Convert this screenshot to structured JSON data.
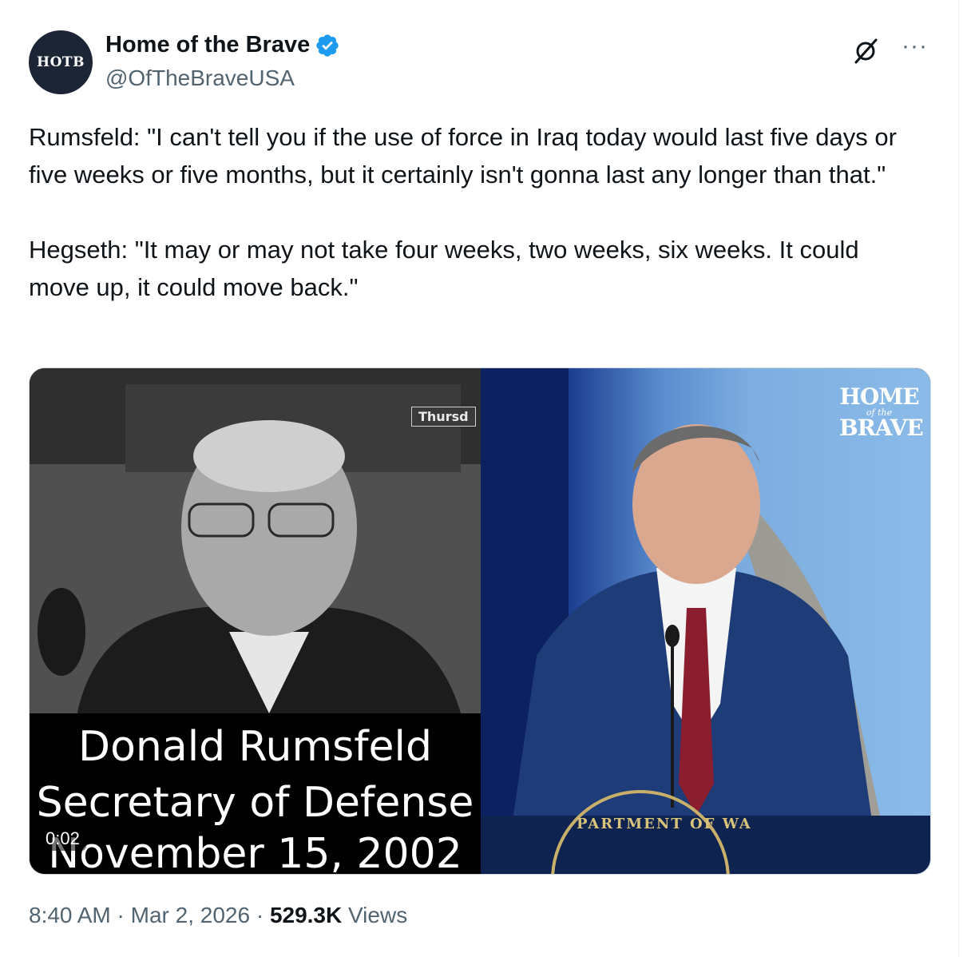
{
  "author": {
    "display_name": "Home of the Brave",
    "handle": "@OfTheBraveUSA",
    "avatar_text": "HOTB",
    "verified": true
  },
  "actions": {
    "grok_icon": "grok-icon",
    "more_label": "···"
  },
  "tweet": {
    "paragraph1": "Rumsfeld: \"I can't tell you if the use of force in Iraq today would last five days or five weeks or five months, but it certainly isn't gonna last any longer than that.\"",
    "paragraph2": "Hegseth: \"It may or may not take four weeks, two weeks, six weeks. It could move up, it could move back.\""
  },
  "media": {
    "left_tag": "Thursd",
    "caption_line1": "Donald Rumsfeld",
    "caption_line2": "Secretary of Defense",
    "caption_line3": "November 15, 2002",
    "video_time": "0:02",
    "logo_line1": "HOME",
    "logo_line2": "of the",
    "logo_line3": "BRAVE",
    "seal_text": "PARTMENT OF WA"
  },
  "meta": {
    "time": "8:40 AM",
    "separator1": " · ",
    "date": "Mar 2, 2026",
    "separator2": " · ",
    "views_count": "529.3K",
    "views_label": " Views"
  },
  "colors": {
    "text_primary": "#0f1419",
    "text_secondary": "#536471",
    "verified_blue": "#1d9bf0",
    "avatar_bg": "#1c2536"
  }
}
